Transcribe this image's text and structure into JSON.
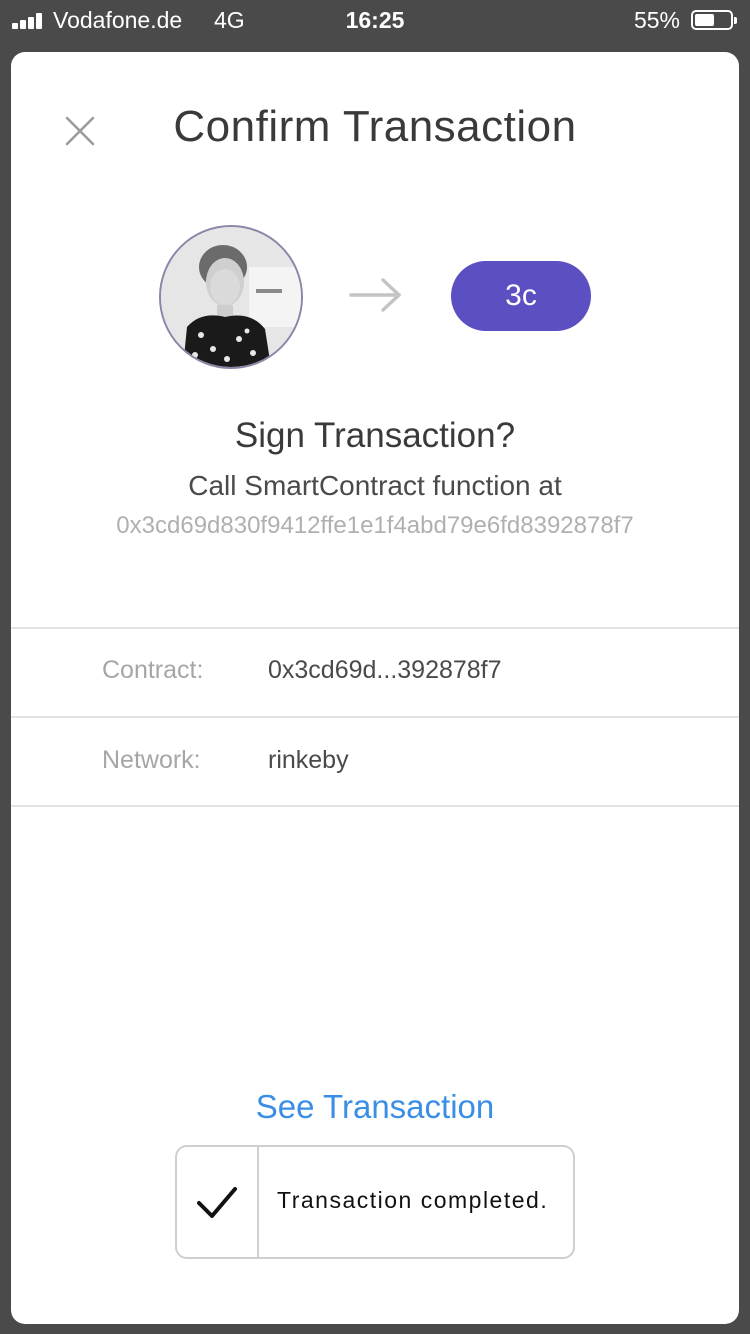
{
  "status_bar": {
    "carrier": "Vodafone.de",
    "network": "4G",
    "time": "16:25",
    "battery_percent_label": "55%",
    "battery_level": 0.55,
    "signal_bars": 4
  },
  "dialog": {
    "title": "Confirm Transaction",
    "recipient_badge": "3c",
    "heading": "Sign Transaction?",
    "description": "Call SmartContract function at",
    "address": "0x3cd69d830f9412ffe1e1f4abd79e6fd8392878f7",
    "details": [
      {
        "label": "Contract:",
        "value": "0x3cd69d...392878f7"
      },
      {
        "label": "Network:",
        "value": "rinkeby"
      }
    ],
    "see_transaction_link": "See Transaction",
    "toast_message": "Transaction completed."
  },
  "colors": {
    "accent_purple": "#5b4fc2",
    "link_blue": "#3a8ee6",
    "title_text": "#3a3a3a",
    "muted_text": "#a6a6a6",
    "backdrop": "#4a4a4a"
  },
  "icons": {
    "close": "close-icon",
    "arrow": "arrow-right-icon",
    "check": "checkmark-icon",
    "signal": "cellular-signal-icon",
    "battery": "battery-icon"
  }
}
